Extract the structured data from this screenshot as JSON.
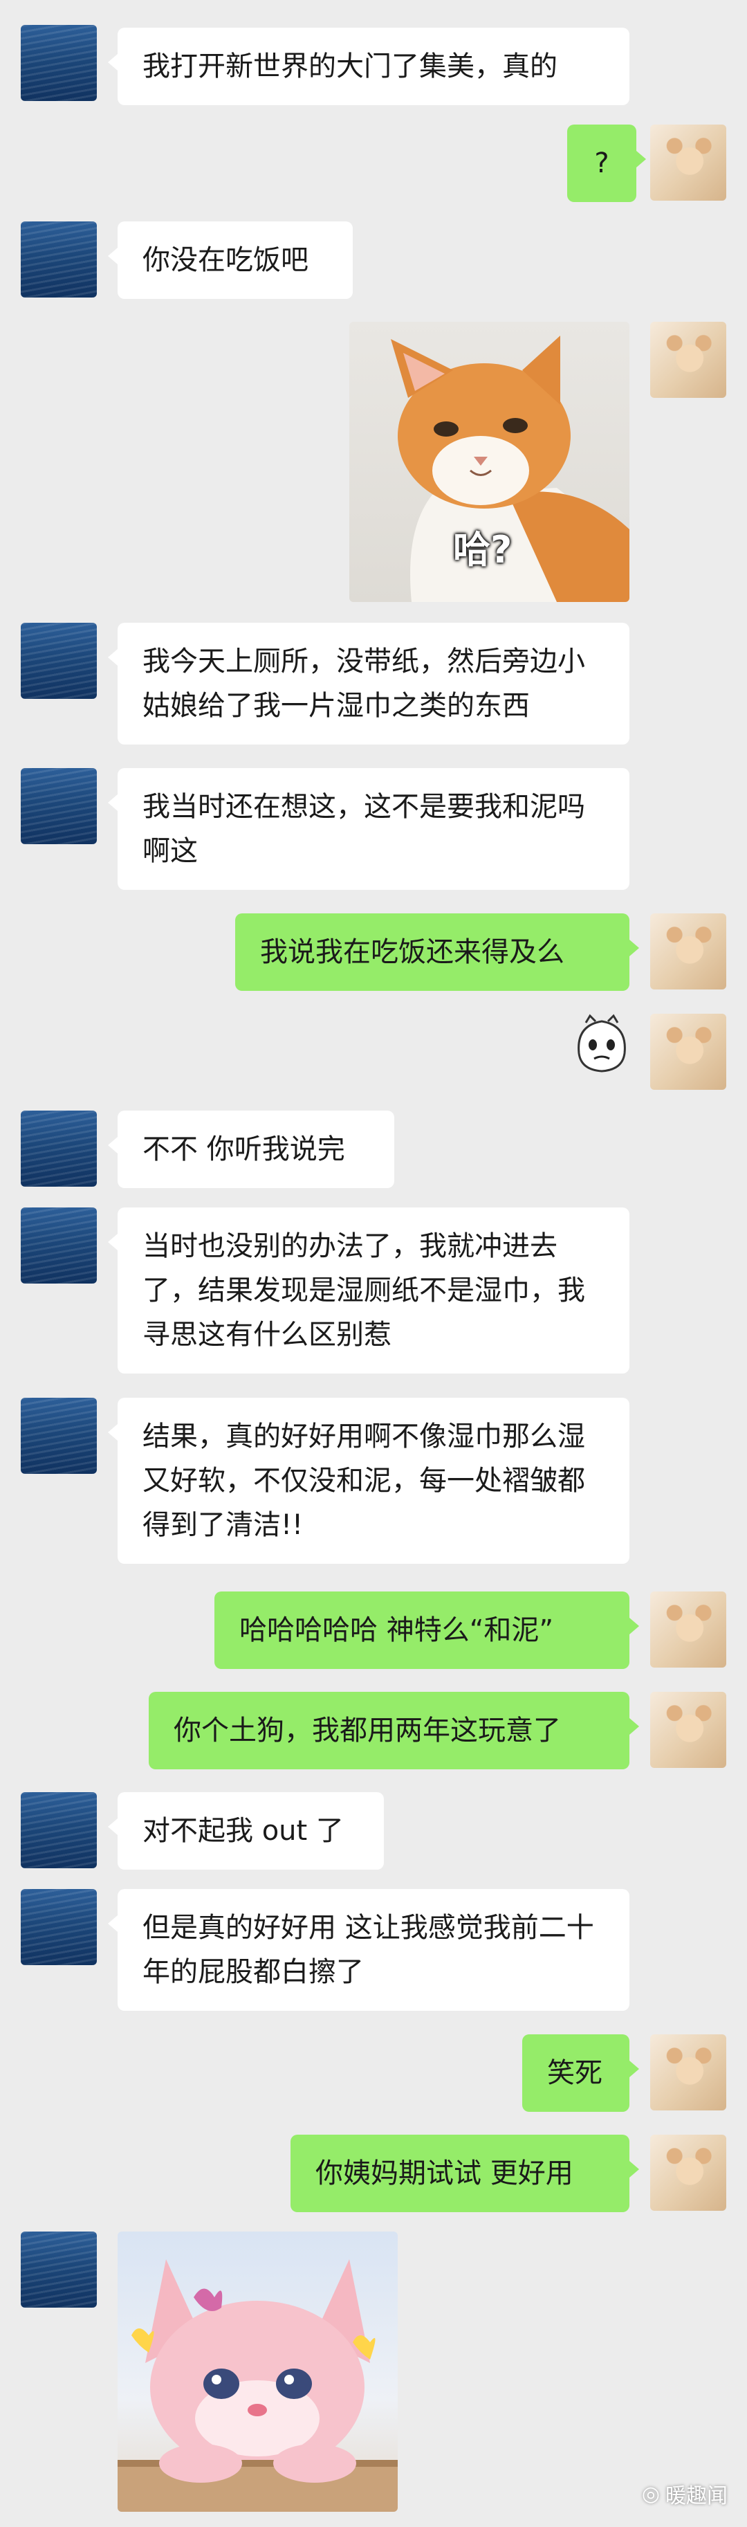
{
  "messages": {
    "m1": "我打开新世界的大门了集美，真的",
    "m2": "?",
    "m3": "你没在吃饭吧",
    "m4_sticker_caption": "哈?",
    "m5": "我今天上厕所，没带纸，然后旁边小姑娘给了我一片湿巾之类的东西",
    "m6": "我当时还在想这，这不是要我和泥吗 啊这",
    "m7": "我说我在吃饭还来得及么",
    "m9": "不不 你听我说完",
    "m10": "当时也没别的办法了，我就冲进去了，结果发现是湿厕纸不是湿巾，我寻思这有什么区别惹",
    "m11": "结果，真的好好用啊不像湿巾那么湿又好软，不仅没和泥，每一处褶皱都得到了清洁!!",
    "m12": "哈哈哈哈哈 神特么“和泥”",
    "m13": "你个土狗，我都用两年这玩意了",
    "m14": "对不起我 out 了",
    "m15": "但是真的好好用 这让我感觉我前二十年的屁股都白擦了",
    "m16": "笑死",
    "m17": "你姨妈期试试 更好用"
  },
  "watermark": "暖趣闻",
  "colors": {
    "background": "#ececec",
    "incoming_bubble": "#ffffff",
    "outgoing_bubble": "#95ec69"
  }
}
